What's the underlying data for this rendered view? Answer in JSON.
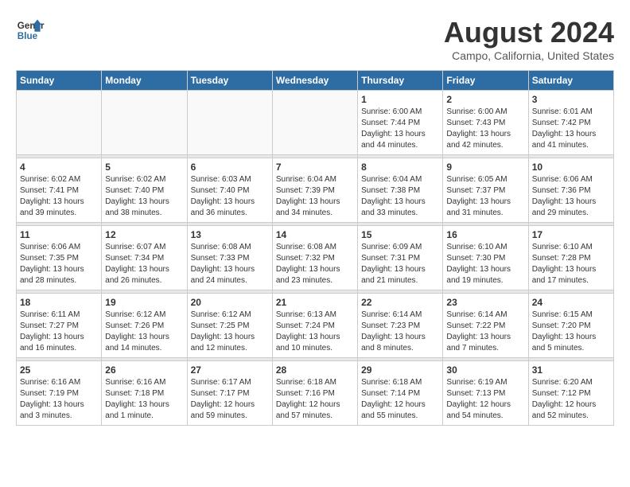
{
  "header": {
    "title": "August 2024",
    "location": "Campo, California, United States",
    "logo_line1": "General",
    "logo_line2": "Blue"
  },
  "weekdays": [
    "Sunday",
    "Monday",
    "Tuesday",
    "Wednesday",
    "Thursday",
    "Friday",
    "Saturday"
  ],
  "weeks": [
    [
      {
        "day": "",
        "info": ""
      },
      {
        "day": "",
        "info": ""
      },
      {
        "day": "",
        "info": ""
      },
      {
        "day": "",
        "info": ""
      },
      {
        "day": "1",
        "info": "Sunrise: 6:00 AM\nSunset: 7:44 PM\nDaylight: 13 hours\nand 44 minutes."
      },
      {
        "day": "2",
        "info": "Sunrise: 6:00 AM\nSunset: 7:43 PM\nDaylight: 13 hours\nand 42 minutes."
      },
      {
        "day": "3",
        "info": "Sunrise: 6:01 AM\nSunset: 7:42 PM\nDaylight: 13 hours\nand 41 minutes."
      }
    ],
    [
      {
        "day": "4",
        "info": "Sunrise: 6:02 AM\nSunset: 7:41 PM\nDaylight: 13 hours\nand 39 minutes."
      },
      {
        "day": "5",
        "info": "Sunrise: 6:02 AM\nSunset: 7:40 PM\nDaylight: 13 hours\nand 38 minutes."
      },
      {
        "day": "6",
        "info": "Sunrise: 6:03 AM\nSunset: 7:40 PM\nDaylight: 13 hours\nand 36 minutes."
      },
      {
        "day": "7",
        "info": "Sunrise: 6:04 AM\nSunset: 7:39 PM\nDaylight: 13 hours\nand 34 minutes."
      },
      {
        "day": "8",
        "info": "Sunrise: 6:04 AM\nSunset: 7:38 PM\nDaylight: 13 hours\nand 33 minutes."
      },
      {
        "day": "9",
        "info": "Sunrise: 6:05 AM\nSunset: 7:37 PM\nDaylight: 13 hours\nand 31 minutes."
      },
      {
        "day": "10",
        "info": "Sunrise: 6:06 AM\nSunset: 7:36 PM\nDaylight: 13 hours\nand 29 minutes."
      }
    ],
    [
      {
        "day": "11",
        "info": "Sunrise: 6:06 AM\nSunset: 7:35 PM\nDaylight: 13 hours\nand 28 minutes."
      },
      {
        "day": "12",
        "info": "Sunrise: 6:07 AM\nSunset: 7:34 PM\nDaylight: 13 hours\nand 26 minutes."
      },
      {
        "day": "13",
        "info": "Sunrise: 6:08 AM\nSunset: 7:33 PM\nDaylight: 13 hours\nand 24 minutes."
      },
      {
        "day": "14",
        "info": "Sunrise: 6:08 AM\nSunset: 7:32 PM\nDaylight: 13 hours\nand 23 minutes."
      },
      {
        "day": "15",
        "info": "Sunrise: 6:09 AM\nSunset: 7:31 PM\nDaylight: 13 hours\nand 21 minutes."
      },
      {
        "day": "16",
        "info": "Sunrise: 6:10 AM\nSunset: 7:30 PM\nDaylight: 13 hours\nand 19 minutes."
      },
      {
        "day": "17",
        "info": "Sunrise: 6:10 AM\nSunset: 7:28 PM\nDaylight: 13 hours\nand 17 minutes."
      }
    ],
    [
      {
        "day": "18",
        "info": "Sunrise: 6:11 AM\nSunset: 7:27 PM\nDaylight: 13 hours\nand 16 minutes."
      },
      {
        "day": "19",
        "info": "Sunrise: 6:12 AM\nSunset: 7:26 PM\nDaylight: 13 hours\nand 14 minutes."
      },
      {
        "day": "20",
        "info": "Sunrise: 6:12 AM\nSunset: 7:25 PM\nDaylight: 13 hours\nand 12 minutes."
      },
      {
        "day": "21",
        "info": "Sunrise: 6:13 AM\nSunset: 7:24 PM\nDaylight: 13 hours\nand 10 minutes."
      },
      {
        "day": "22",
        "info": "Sunrise: 6:14 AM\nSunset: 7:23 PM\nDaylight: 13 hours\nand 8 minutes."
      },
      {
        "day": "23",
        "info": "Sunrise: 6:14 AM\nSunset: 7:22 PM\nDaylight: 13 hours\nand 7 minutes."
      },
      {
        "day": "24",
        "info": "Sunrise: 6:15 AM\nSunset: 7:20 PM\nDaylight: 13 hours\nand 5 minutes."
      }
    ],
    [
      {
        "day": "25",
        "info": "Sunrise: 6:16 AM\nSunset: 7:19 PM\nDaylight: 13 hours\nand 3 minutes."
      },
      {
        "day": "26",
        "info": "Sunrise: 6:16 AM\nSunset: 7:18 PM\nDaylight: 13 hours\nand 1 minute."
      },
      {
        "day": "27",
        "info": "Sunrise: 6:17 AM\nSunset: 7:17 PM\nDaylight: 12 hours\nand 59 minutes."
      },
      {
        "day": "28",
        "info": "Sunrise: 6:18 AM\nSunset: 7:16 PM\nDaylight: 12 hours\nand 57 minutes."
      },
      {
        "day": "29",
        "info": "Sunrise: 6:18 AM\nSunset: 7:14 PM\nDaylight: 12 hours\nand 55 minutes."
      },
      {
        "day": "30",
        "info": "Sunrise: 6:19 AM\nSunset: 7:13 PM\nDaylight: 12 hours\nand 54 minutes."
      },
      {
        "day": "31",
        "info": "Sunrise: 6:20 AM\nSunset: 7:12 PM\nDaylight: 12 hours\nand 52 minutes."
      }
    ]
  ]
}
